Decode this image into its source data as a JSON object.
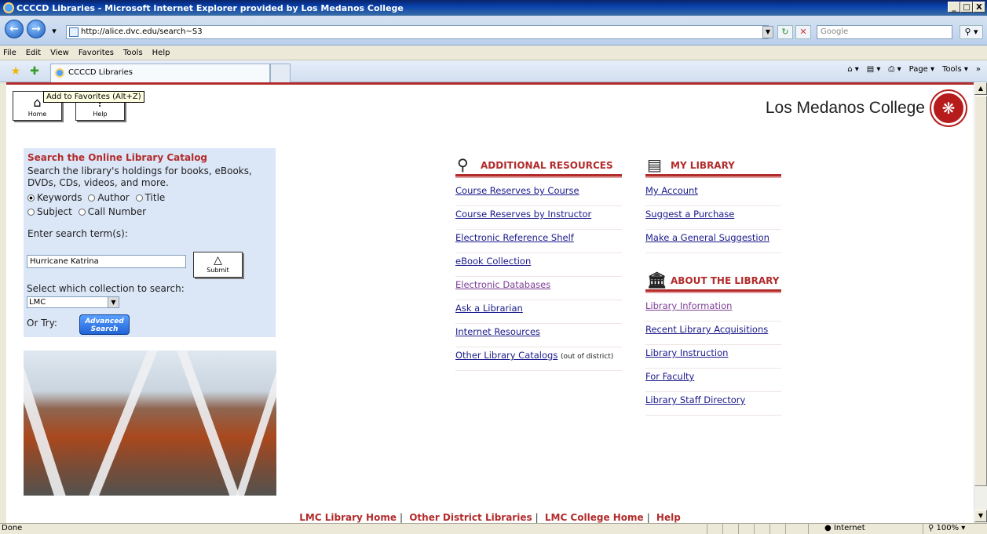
{
  "window": {
    "title": "CCCCD Libraries - Microsoft Internet Explorer provided by Los Medanos College",
    "buttons": [
      "_",
      "□",
      "X"
    ]
  },
  "address": {
    "url": "http://alice.dvc.edu/search~S3",
    "search_placeholder": "Google"
  },
  "menu": [
    "File",
    "Edit",
    "View",
    "Favorites",
    "Tools",
    "Help"
  ],
  "tab": {
    "label": "CCCCD Libraries"
  },
  "command_bar": {
    "page": "Page",
    "tools": "Tools"
  },
  "tooltip": "Add to Favorites (Alt+Z)",
  "top_buttons": {
    "home": "Home",
    "help": "Help"
  },
  "logo_text": "Los Medanos College",
  "search": {
    "heading": "Search the Online Library Catalog",
    "description": "Search the library's holdings for books, eBooks, DVDs, CDs, videos, and more.",
    "options": [
      {
        "label": "Keywords",
        "selected": true
      },
      {
        "label": "Author",
        "selected": false
      },
      {
        "label": "Title",
        "selected": false
      },
      {
        "label": "Subject",
        "selected": false
      },
      {
        "label": "Call Number",
        "selected": false
      }
    ],
    "term_label": "Enter search term(s):",
    "term_value": "Hurricane Katrina",
    "submit_label": "Submit",
    "collection_label": "Select which collection to search:",
    "collection_value": "LMC",
    "or_try": "Or Try:",
    "advanced_label_1": "Advanced",
    "advanced_label_2": "Search"
  },
  "additional_resources": {
    "heading": "ADDITIONAL RESOURCES",
    "links": [
      "Course Reserves by Course",
      "Course Reserves by Instructor",
      "Electronic Reference Shelf",
      "eBook Collection",
      "Electronic Databases",
      "Ask a Librarian",
      "Internet Resources",
      "Other Library Catalogs"
    ],
    "other_note": "(out of district)"
  },
  "my_library": {
    "heading": "MY LIBRARY",
    "links": [
      "My Account",
      "Suggest a Purchase",
      "Make a General Suggestion"
    ]
  },
  "about_library": {
    "heading": "ABOUT THE LIBRARY",
    "links": [
      "Library Information",
      "Recent Library Acquisitions",
      "Library Instruction",
      "For Faculty",
      "Library Staff Directory"
    ]
  },
  "footer": [
    "LMC Library Home",
    "Other District Libraries",
    "LMC College Home",
    "Help"
  ],
  "status": {
    "text": "Done",
    "zone": "Internet",
    "zoom": "100%"
  },
  "colors": {
    "accent": "#b22c2c",
    "panel": "#dbe6f7",
    "link": "#1a1a8c"
  }
}
